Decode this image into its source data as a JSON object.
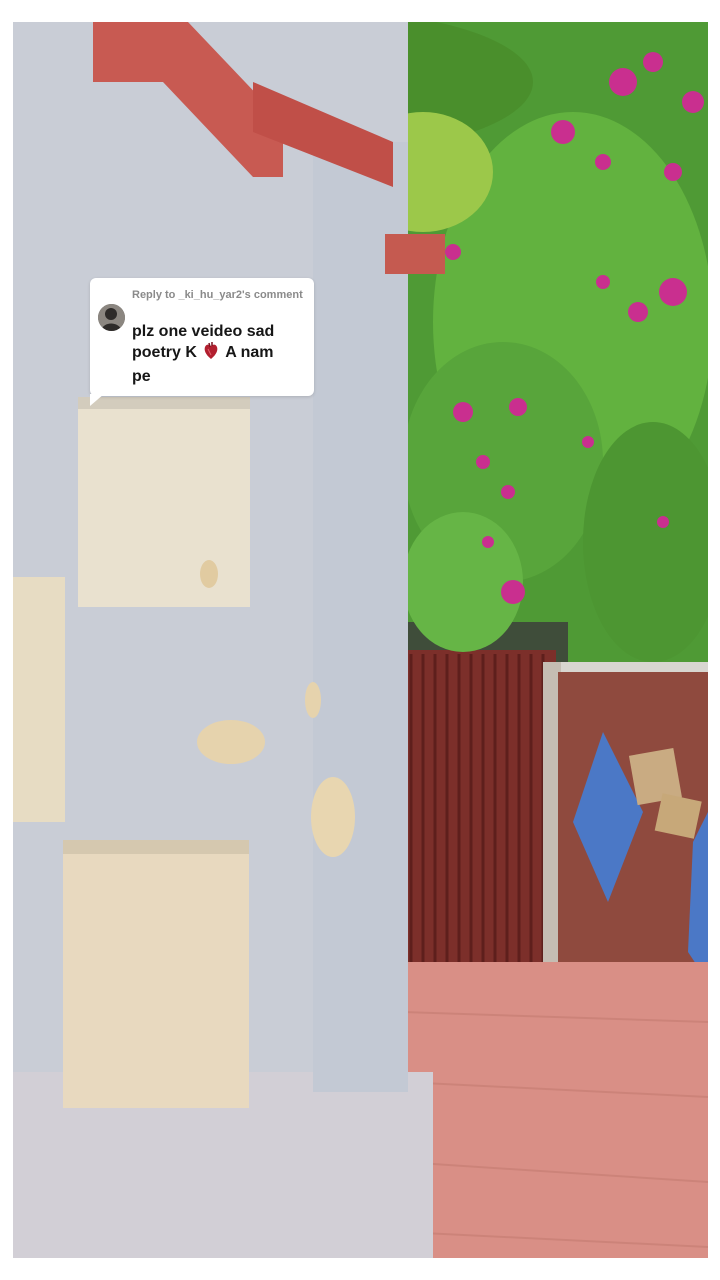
{
  "reply": {
    "header": "Reply to _ki_hu_yar2's comment",
    "line1": "plz one veideo sad",
    "line2_pre": "poetry K",
    "line2_post": "A nam",
    "line3": "pe",
    "heart_icon": "anatomical-heart-icon"
  },
  "colors": {
    "wall": "#c9cdd6",
    "brick": "#8a3c34",
    "foliage": "#5aa83a",
    "flowers": "#c92f8f",
    "sky": "#b9d6ee",
    "floor": "#d98f86"
  }
}
